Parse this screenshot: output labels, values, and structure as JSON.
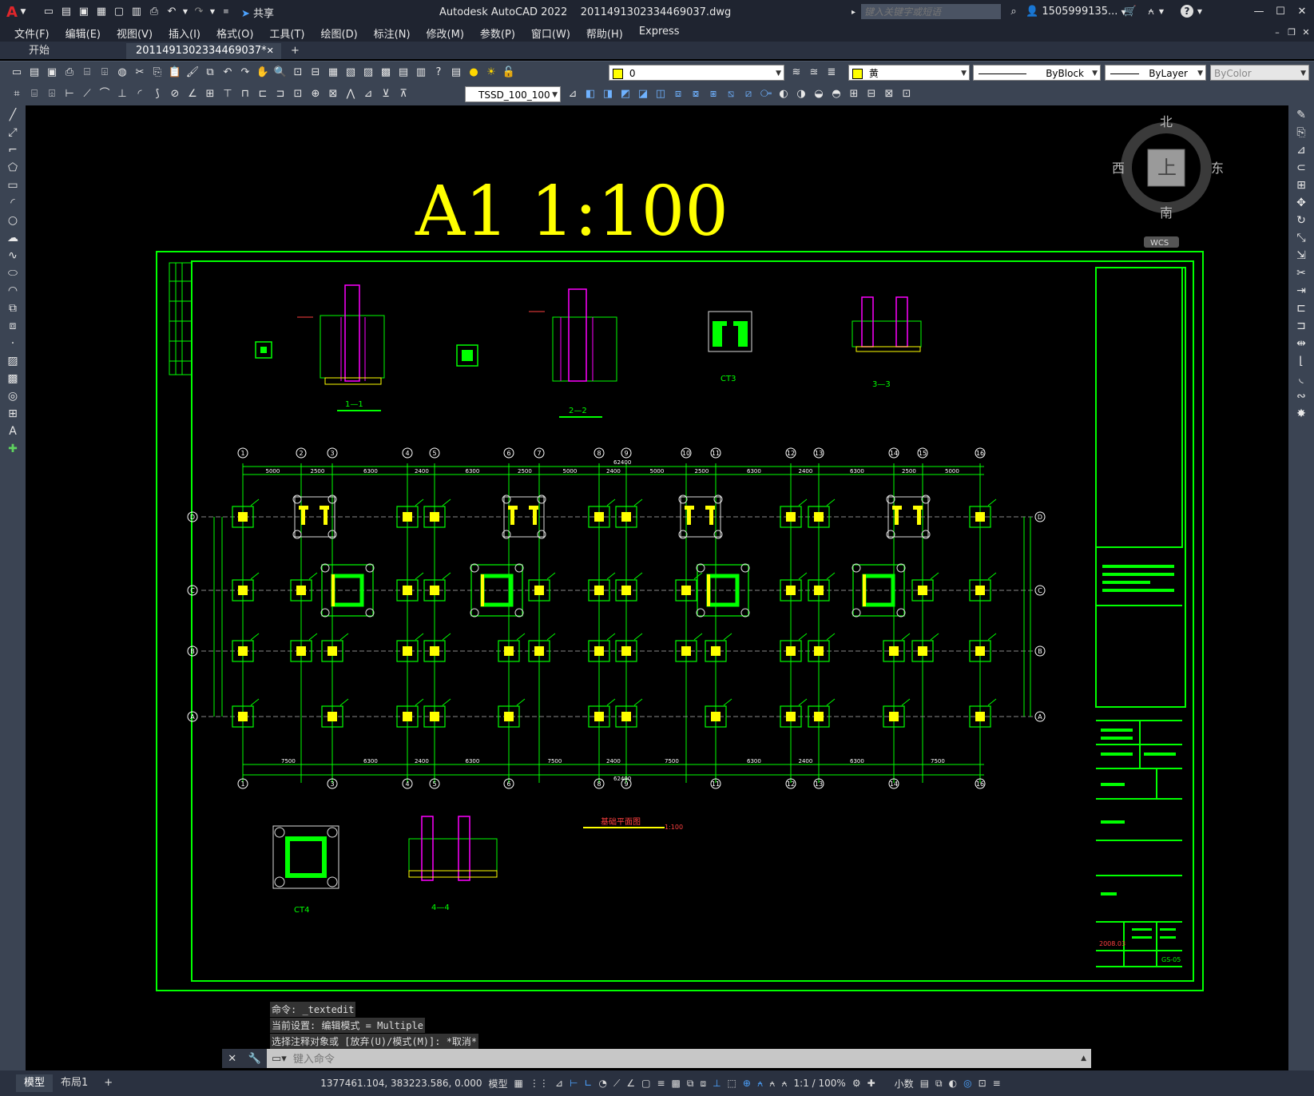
{
  "title": {
    "app": "Autodesk AutoCAD 2022",
    "file": "2011491302334469037.dwg",
    "share": "共享",
    "search_placeholder": "键入关键字或短语",
    "user": "1505999135..."
  },
  "menu": [
    "文件(F)",
    "编辑(E)",
    "视图(V)",
    "插入(I)",
    "格式(O)",
    "工具(T)",
    "绘图(D)",
    "标注(N)",
    "修改(M)",
    "参数(P)",
    "窗口(W)",
    "帮助(H)",
    "Express"
  ],
  "tabs": {
    "start": "开始",
    "doc": "2011491302334469037*"
  },
  "toolbar": {
    "layer": "0",
    "color": "黄",
    "linetype": "ByBlock",
    "lineweight": "ByLayer",
    "plotstyle": "ByColor",
    "dimstyle": "TSSD_100_100"
  },
  "viewcube": {
    "north": "北",
    "south": "南",
    "east": "东",
    "west": "西",
    "top": "上",
    "wcs": "WCS"
  },
  "drawing": {
    "scale_title": "A1  1:100",
    "plan_title": "基础平面图",
    "plan_scale": "1:100",
    "section1": "1—1",
    "section2": "2—2",
    "section3": "3—3",
    "section4": "4—4",
    "ct3": "CT3",
    "ct4": "CT4",
    "sheet_no": "GS-05",
    "date": "2008.03",
    "top_dims": [
      "5000",
      "2500",
      "6300",
      "2400",
      "6300",
      "2500",
      "5000",
      "2400",
      "5000",
      "2500",
      "6300",
      "2400",
      "6300",
      "2500",
      "5000"
    ],
    "bottom_dims": [
      "7500",
      "6300",
      "2400",
      "6300",
      "7500",
      "2400",
      "7500",
      "6300",
      "2400",
      "6300",
      "7500"
    ],
    "total_dim": "62400",
    "top_axes": [
      "1",
      "2",
      "3",
      "4",
      "5",
      "6",
      "7",
      "8",
      "9",
      "10",
      "11",
      "12",
      "13",
      "14",
      "15",
      "16"
    ],
    "bottom_axes": [
      "1",
      "3",
      "4",
      "5",
      "6",
      "8",
      "9",
      "11",
      "12",
      "13",
      "14",
      "16"
    ],
    "row_axes": [
      "D",
      "C",
      "B",
      "A"
    ]
  },
  "command": {
    "history": [
      "命令: _textedit",
      "当前设置: 编辑模式 = Multiple",
      "选择注释对象或 [放弃(U)/模式(M)]: *取消*"
    ],
    "placeholder": "键入命令"
  },
  "status": {
    "model_tab": "模型",
    "layout_tab": "布局1",
    "coords": "1377461.104, 383223.586, 0.000",
    "space": "模型",
    "scale": "1:1 / 100%",
    "units": "小数"
  }
}
